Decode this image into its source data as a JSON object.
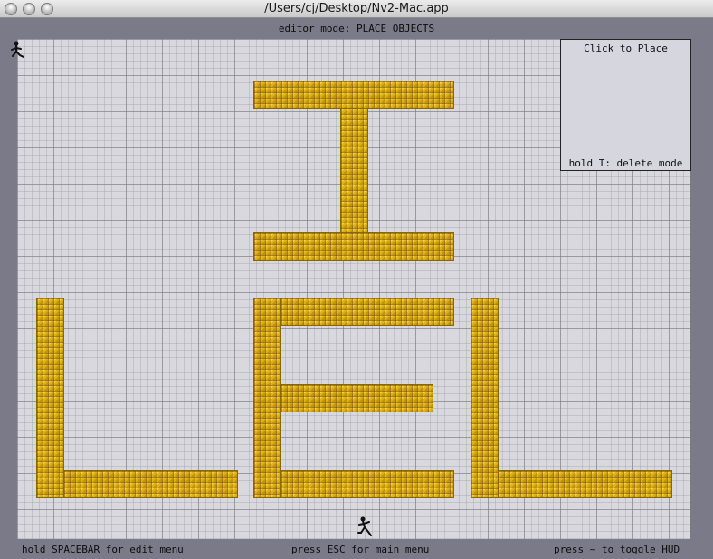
{
  "window": {
    "title": "/Users/cj/Desktop/Nv2-Mac.app"
  },
  "editor": {
    "mode": "editor mode: PLACE OBJECTS"
  },
  "palette": {
    "title": "Click to Place",
    "hint": "hold T: delete mode"
  },
  "hud": {
    "left": "hold SPACEBAR for edit menu",
    "center": "press ESC for main menu",
    "right": "press ~ to toggle HUD"
  },
  "colors": {
    "tile": "#e1b214",
    "grid": "#d8d8de",
    "frame": "#7a7a88"
  },
  "icons": [
    "close-button-icon",
    "minimize-button-icon",
    "zoom-button-icon",
    "ninja-player-icon",
    "ninja-spawn-icon"
  ]
}
